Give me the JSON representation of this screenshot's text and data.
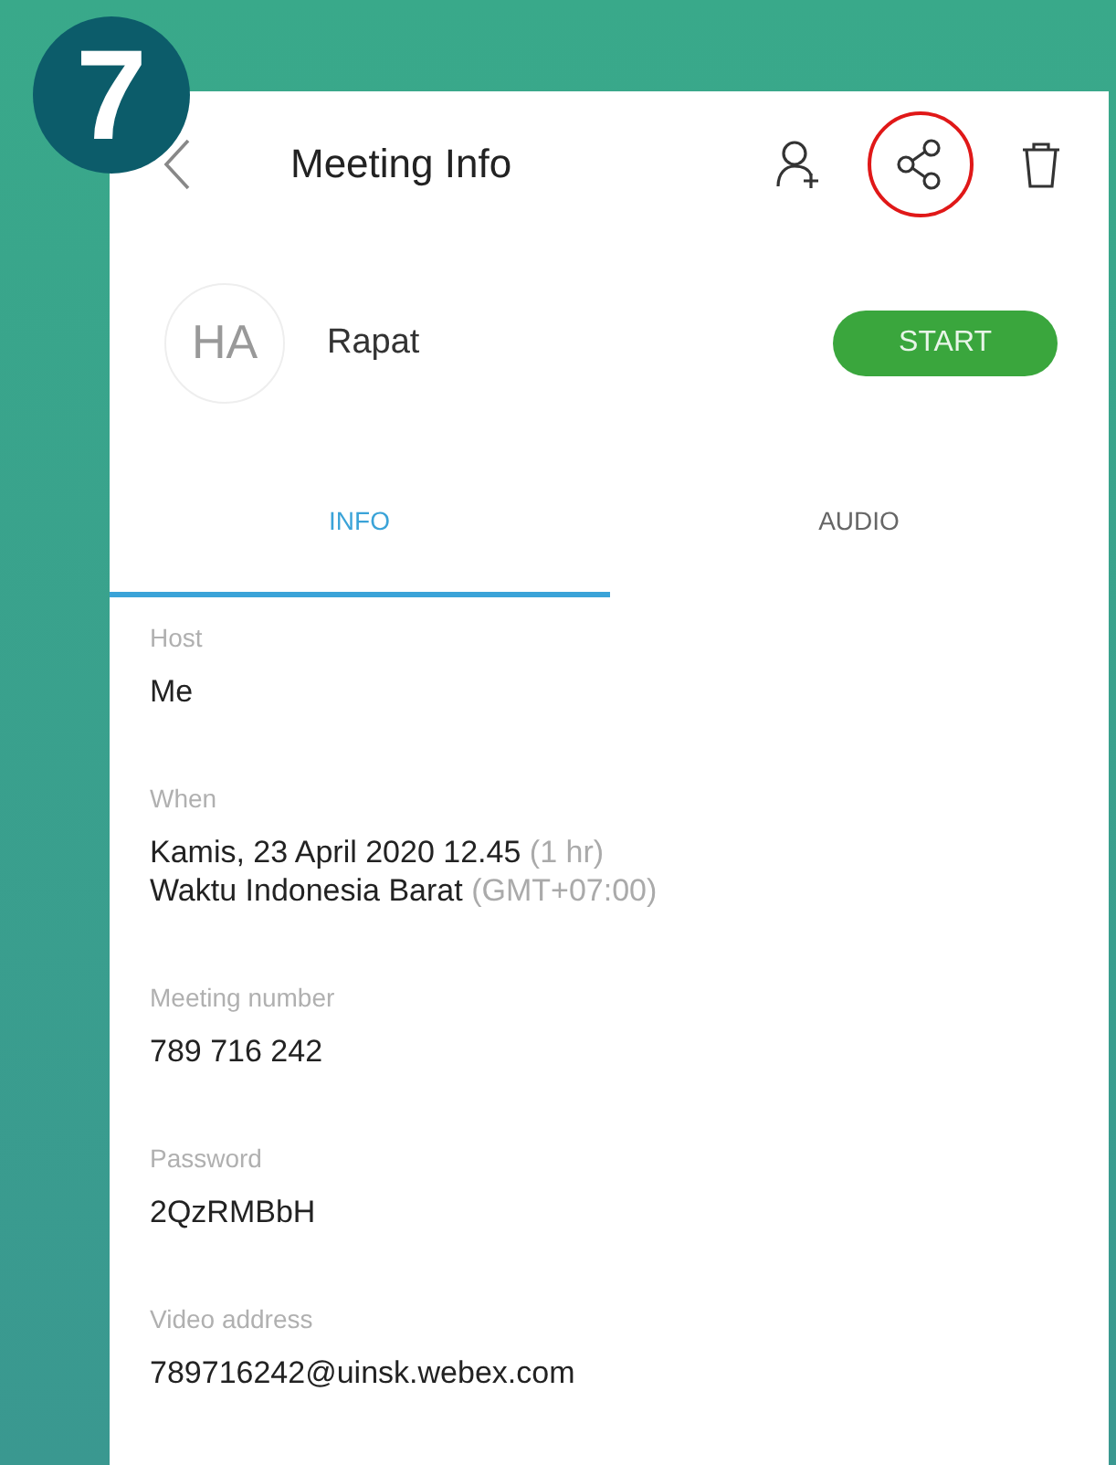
{
  "step_badge": "7",
  "header": {
    "title": "Meeting Info",
    "actions": [
      {
        "kind": "add-person",
        "highlighted": false
      },
      {
        "kind": "share",
        "highlighted": true
      },
      {
        "kind": "delete",
        "highlighted": false
      }
    ]
  },
  "meeting": {
    "avatar": "HA",
    "name": "Rapat",
    "button": "START"
  },
  "tabs": [
    {
      "label": "INFO",
      "selected": true
    },
    {
      "label": "AUDIO",
      "selected": false
    }
  ],
  "fields": [
    {
      "label": "Host",
      "lines": [
        {
          "text": "Me"
        }
      ]
    },
    {
      "label": "When",
      "lines": [
        {
          "text": "Kamis, 23 April 2020 12.45",
          "note": "(1 hr)"
        },
        {
          "text": "Waktu Indonesia Barat",
          "note": "(GMT+07:00)"
        }
      ]
    },
    {
      "label": "Meeting number",
      "lines": [
        {
          "text": "789 716 242"
        }
      ]
    },
    {
      "label": "Password",
      "lines": [
        {
          "text": "2QzRMBbH"
        }
      ]
    },
    {
      "label": "Video address",
      "lines": [
        {
          "text": "789716242@uinsk.webex.com"
        }
      ]
    }
  ]
}
